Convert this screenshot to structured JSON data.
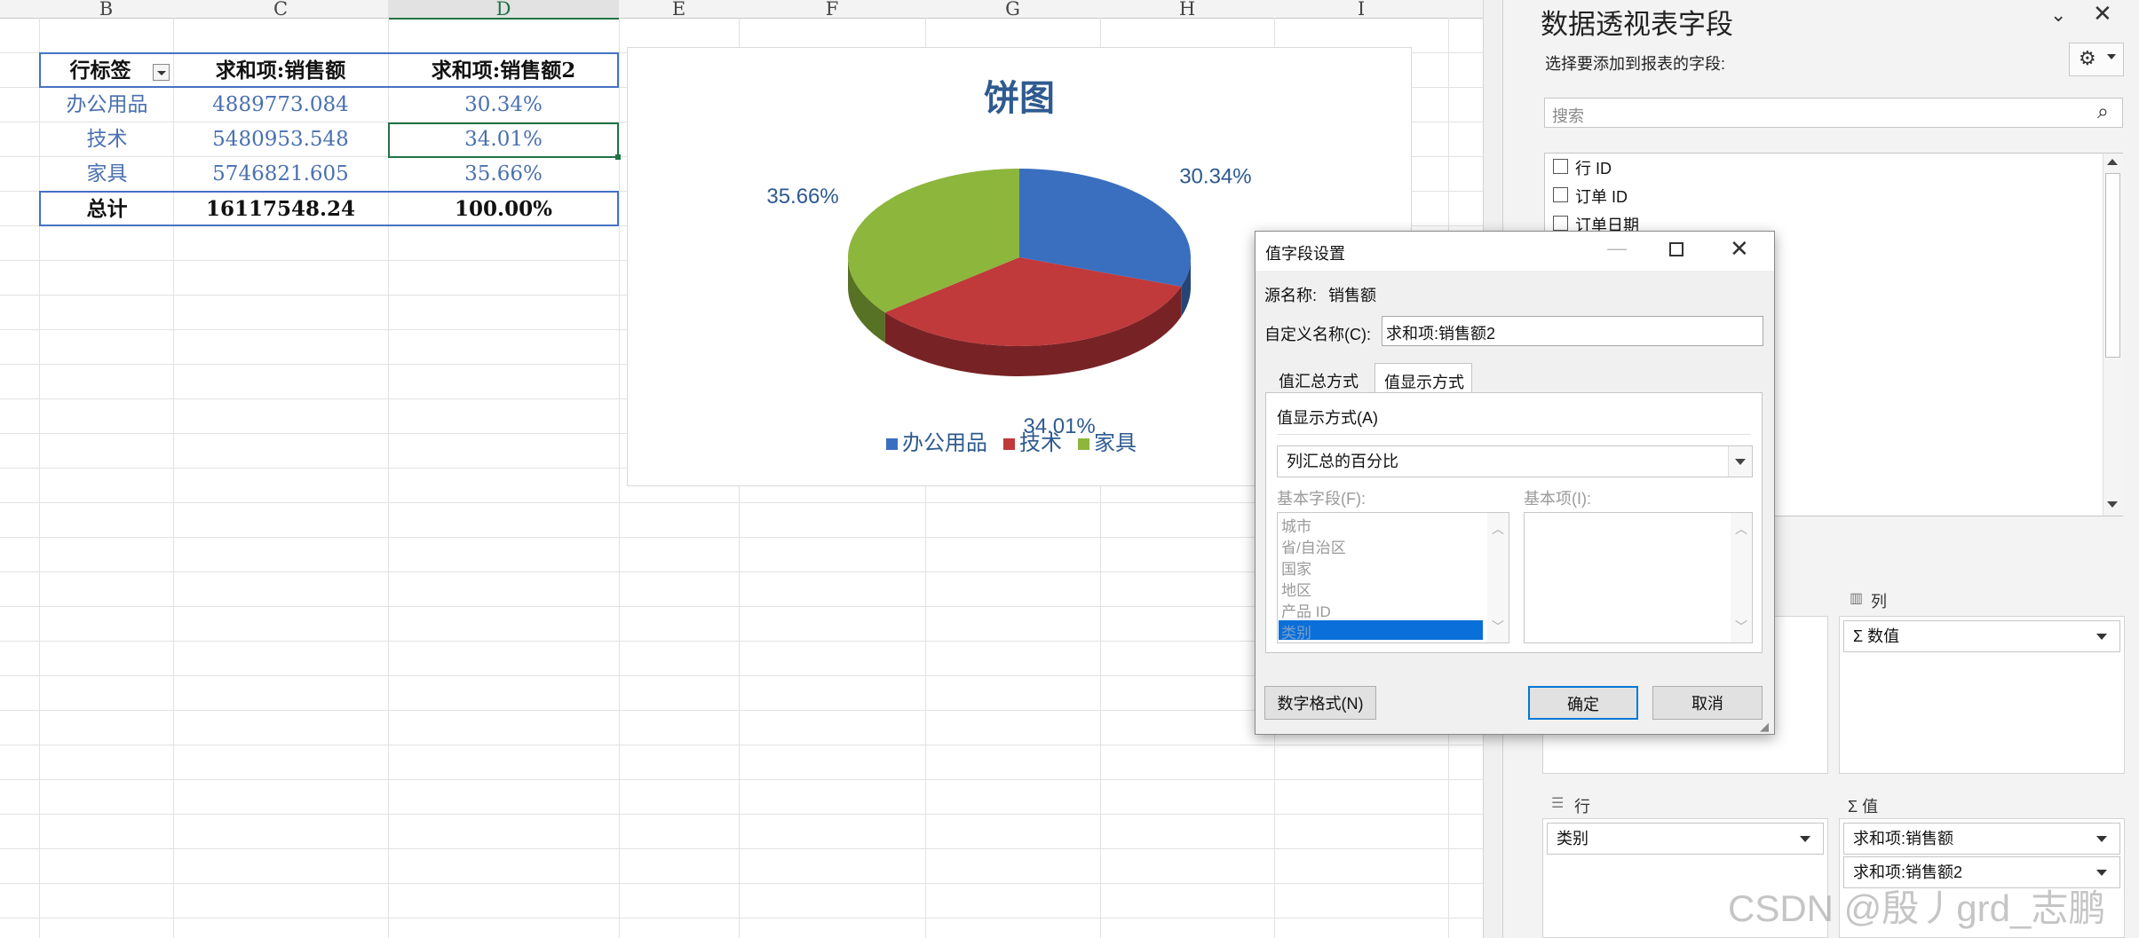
{
  "columns": [
    "B",
    "C",
    "D",
    "E",
    "F",
    "G",
    "H",
    "I"
  ],
  "pivot_table": {
    "headers": [
      "行标签",
      "求和项:销售额",
      "求和项:销售额2"
    ],
    "rows": [
      {
        "label": "办公用品",
        "sum": "4889773.084",
        "pct": "30.34%"
      },
      {
        "label": "技术",
        "sum": "5480953.548",
        "pct": "34.01%"
      },
      {
        "label": "家具",
        "sum": "5746821.605",
        "pct": "35.66%"
      }
    ],
    "total": {
      "label": "总计",
      "sum": "16117548.24",
      "pct": "100.00%"
    }
  },
  "chart_data": {
    "type": "pie",
    "title": "饼图",
    "categories": [
      "办公用品",
      "技术",
      "家具"
    ],
    "values": [
      30.34,
      34.01,
      35.66
    ],
    "data_labels": [
      "30.34%",
      "34.01%",
      "35.66%"
    ],
    "colors": [
      "#3a6fbf",
      "#c0393b",
      "#8db63c"
    ],
    "legend_position": "bottom"
  },
  "pane": {
    "title": "数据透视表字段",
    "subtitle": "选择要添加到报表的字段:",
    "search_placeholder": "搜索",
    "fields": [
      "行 ID",
      "订单 ID",
      "订单日期"
    ],
    "areas": {
      "columns_label": "列",
      "columns_item": "Σ 数值",
      "rows_label": "行",
      "rows_item": "类别",
      "values_label": "Σ 值",
      "values_items": [
        "求和项:销售额",
        "求和项:销售额2"
      ]
    }
  },
  "dialog": {
    "title": "值字段设置",
    "source_label": "源名称:",
    "source_value": "销售额",
    "custom_name_label": "自定义名称(C):",
    "custom_name_value": "求和项:销售额2",
    "tabs": [
      "值汇总方式",
      "值显示方式"
    ],
    "show_as_label": "值显示方式(A)",
    "show_as_value": "列汇总的百分比",
    "base_field_label": "基本字段(F):",
    "base_item_label": "基本项(I):",
    "base_fields": [
      "城市",
      "省/自治区",
      "国家",
      "地区",
      "产品 ID",
      "类别"
    ],
    "number_format_button": "数字格式(N)",
    "ok_button": "确定",
    "cancel_button": "取消"
  },
  "watermark": "CSDN @殷丿grd_志鹏"
}
